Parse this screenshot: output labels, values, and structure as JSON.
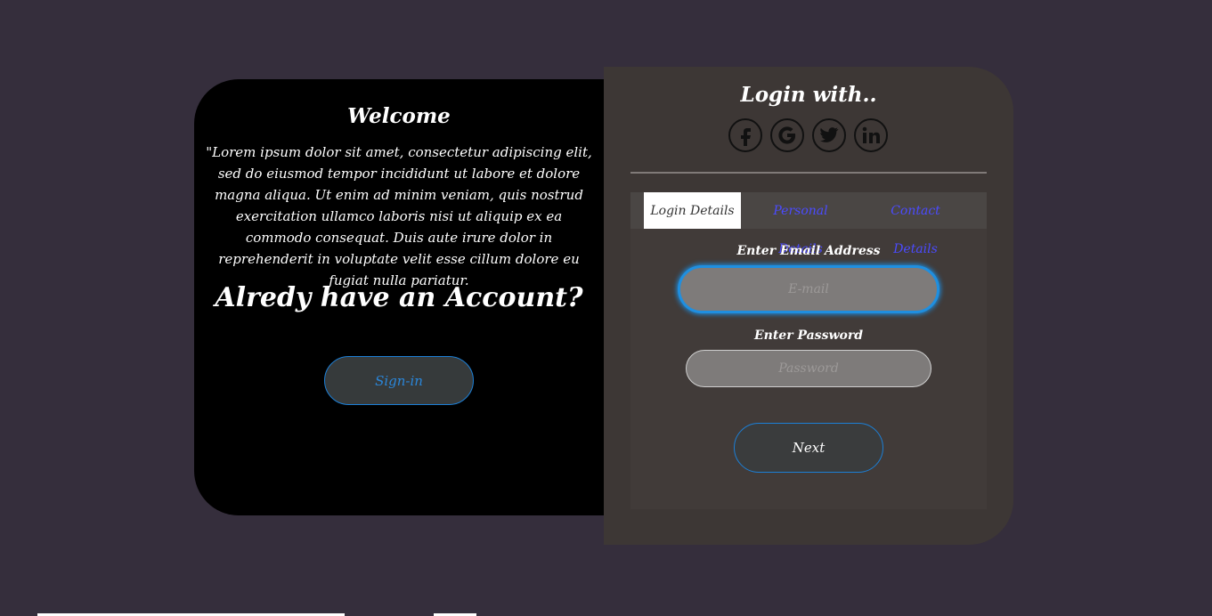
{
  "welcome": {
    "title": "Welcome",
    "text": "\"Lorem ipsum dolor sit amet, consectetur adipiscing elit, sed do eiusmod tempor incididunt ut labore et dolore magna aliqua. Ut enim ad minim veniam, quis nostrud exercitation ullamco laboris nisi ut aliquip ex ea commodo consequat. Duis aute irure dolor in reprehenderit in voluptate velit esse cillum dolore eu fugiat nulla pariatur.",
    "account_heading": "Alredy have an Account?",
    "signin_label": "Sign-in"
  },
  "login": {
    "heading": "Login with..",
    "social": [
      {
        "name": "facebook-icon",
        "glyph": "f"
      },
      {
        "name": "google-icon",
        "glyph": "G"
      },
      {
        "name": "twitter-icon",
        "glyph": "t"
      },
      {
        "name": "linkedin-icon",
        "glyph": "in"
      }
    ]
  },
  "tabs": [
    {
      "label": "Login Details",
      "active": true
    },
    {
      "label": "Personal Details",
      "active": false
    },
    {
      "label": "Contact Details",
      "active": false
    }
  ],
  "form": {
    "email_label": "Enter Email Address",
    "email_placeholder": "E-mail",
    "email_value": "",
    "password_label": "Enter Password",
    "password_placeholder": "Password",
    "password_value": "",
    "next_label": "Next"
  },
  "colors": {
    "background": "#352e3c",
    "left_panel": "#000000",
    "right_panel": "#3d3735",
    "accent_blue": "#1f8fe0",
    "tab_inactive_text": "#4b4bff"
  }
}
